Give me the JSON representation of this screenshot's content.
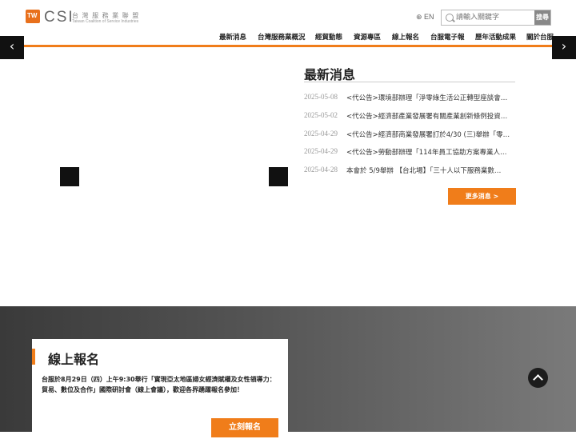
{
  "logo": {
    "badge": "TW",
    "name": "CSI",
    "cn": "台 灣 服 務 業 聯 盟",
    "en": "Taiwan Coalition of Service Industries"
  },
  "header": {
    "lang": "⊕ EN",
    "search_placeholder": "請輸入關鍵字",
    "search_button": "搜尋"
  },
  "nav": [
    "最新消息",
    "台灣服務業概況",
    "經貿動態",
    "資源專區",
    "線上報名",
    "台服電子報",
    "歷年活動成果",
    "關於台服"
  ],
  "slider": {
    "prev": "‹",
    "next": "›"
  },
  "news": {
    "title": "最新消息",
    "items": [
      {
        "date": "2025-05-08",
        "text": "<代公告>環境部辦理「淨零綠生活公正轉型座談會…"
      },
      {
        "date": "2025-05-02",
        "text": "<代公告>經濟部產業發展署有關產業創新條例投資…"
      },
      {
        "date": "2025-04-29",
        "text": "<代公告>經濟部商業發展署訂於4/30 (三)舉辦「零…"
      },
      {
        "date": "2025-04-29",
        "text": "<代公告>勞動部辦理「114年員工協助方案專業人…"
      },
      {
        "date": "2025-04-28",
        "text": "本會於 5/9舉辦 【台北場】「三十人以下服務業數…"
      }
    ],
    "more": "更多消息 >"
  },
  "signup": {
    "title": "線上報名",
    "text": "台服於8月29日（四）上午9:30舉行「實現亞太地區婦女經濟賦權及女性領導力：貿易、數位及合作」國際研討會（線上會議），歡迎各界踴躍報名參加！",
    "button": "立刻報名"
  },
  "colors": {
    "accent": "#f07d1a",
    "band": "#555555"
  }
}
